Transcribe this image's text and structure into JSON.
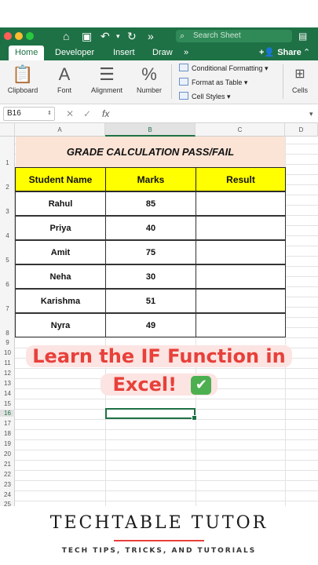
{
  "quick_access": {
    "icons": [
      "home-icon",
      "save-icon",
      "undo-icon",
      "redo-icon",
      "more-icon"
    ]
  },
  "search": {
    "placeholder": "Search Sheet"
  },
  "tabs": [
    {
      "label": "Home",
      "active": true
    },
    {
      "label": "Developer"
    },
    {
      "label": "Insert"
    },
    {
      "label": "Draw"
    }
  ],
  "share_label": "Share",
  "ribbon": {
    "groups": [
      "Clipboard",
      "Font",
      "Alignment",
      "Number",
      "Cells"
    ],
    "styles": [
      "Conditional Formatting",
      "Format as Table",
      "Cell Styles"
    ]
  },
  "formula_bar": {
    "name_box": "B16",
    "fx": "fx"
  },
  "columns": [
    "A",
    "B",
    "C",
    "D"
  ],
  "rows": [
    "1",
    "2",
    "3",
    "4",
    "5",
    "6",
    "7",
    "8",
    "9",
    "10",
    "11",
    "12",
    "13",
    "14",
    "15",
    "16",
    "17",
    "18",
    "19",
    "20",
    "21",
    "22",
    "23",
    "24",
    "25"
  ],
  "table": {
    "title": "GRADE CALCULATION PASS/FAIL",
    "headers": [
      "Student Name",
      "Marks",
      "Result"
    ],
    "records": [
      {
        "name": "Rahul",
        "marks": "85",
        "result": ""
      },
      {
        "name": "Priya",
        "marks": "40",
        "result": ""
      },
      {
        "name": "Amit",
        "marks": "75",
        "result": ""
      },
      {
        "name": "Neha",
        "marks": "30",
        "result": ""
      },
      {
        "name": "Karishma",
        "marks": "51",
        "result": ""
      },
      {
        "name": "Nyra",
        "marks": "49",
        "result": ""
      }
    ]
  },
  "caption": {
    "line1": "Learn the IF Function in",
    "line2": "Excel!"
  },
  "brand": {
    "title": "TECHTABLE TUTOR",
    "subtitle": "TECH TIPS, TRICKS, AND TUTORIALS"
  },
  "colors": {
    "excel_green": "#1e7145",
    "header_yellow": "#ffff00",
    "title_peach": "#fbe4d6",
    "caption_red": "#e8403a"
  }
}
